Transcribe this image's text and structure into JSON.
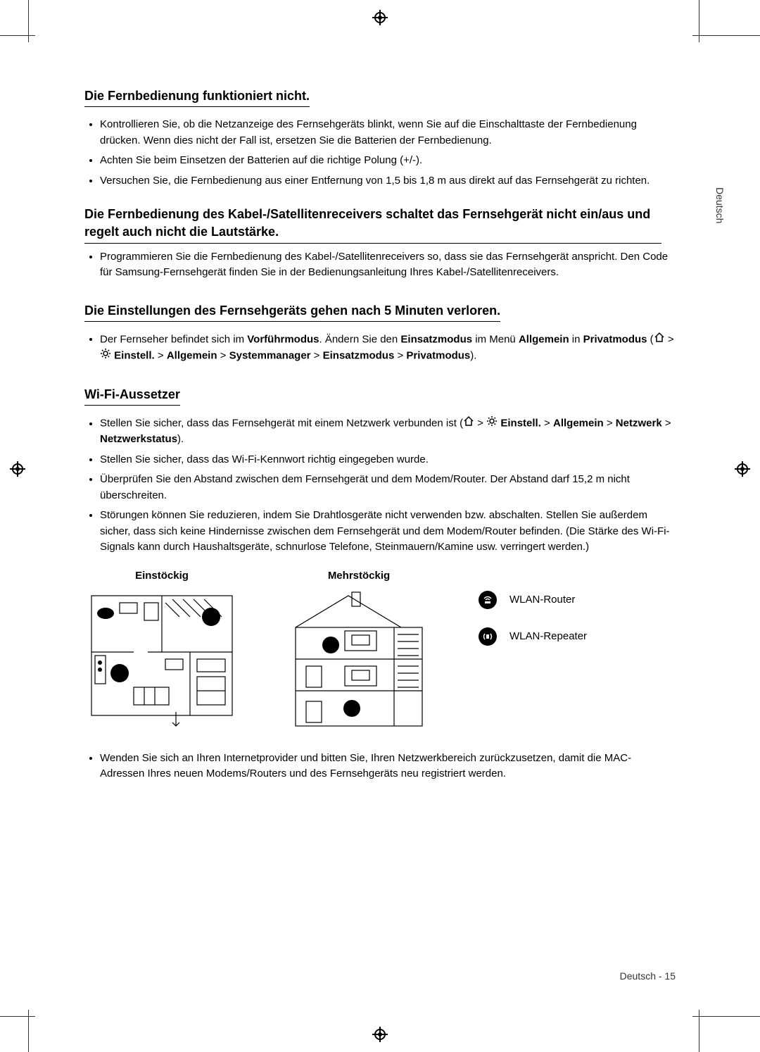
{
  "side_tab": "Deutsch",
  "footer": "Deutsch - 15",
  "sections": {
    "s1": {
      "heading": "Die Fernbedienung funktioniert nicht.",
      "b1": "Kontrollieren Sie, ob die Netzanzeige des Fernsehgeräts blinkt, wenn Sie auf die Einschalttaste der Fernbedienung drücken. Wenn dies nicht der Fall ist, ersetzen Sie die Batterien der Fernbedienung.",
      "b2": "Achten Sie beim Einsetzen der Batterien auf die richtige Polung (+/-).",
      "b3": "Versuchen Sie, die Fernbedienung aus einer Entfernung von 1,5 bis 1,8 m aus direkt auf das Fernsehgerät zu richten."
    },
    "s2": {
      "heading": "Die Fernbedienung des Kabel-/Satellitenreceivers schaltet das Fernsehgerät nicht ein/aus und regelt auch nicht die Lautstärke.",
      "b1": "Programmieren Sie die Fernbedienung des Kabel-/Satellitenreceivers so, dass sie das Fernsehgerät anspricht. Den Code für Samsung-Fernsehgerät finden Sie in der Bedienungsanleitung Ihres Kabel-/Satellitenreceivers."
    },
    "s3": {
      "heading": "Die Einstellungen des Fernsehgeräts gehen nach 5 Minuten verloren.",
      "b1_pre": "Der Fernseher befindet sich im ",
      "b1_bold1": "Vorführmodus",
      "b1_mid1": ". Ändern Sie den ",
      "b1_bold2": "Einsatzmodus",
      "b1_mid2": " im Menü ",
      "b1_bold3": "Allgemein",
      "b1_mid3": " in ",
      "b1_bold4": "Privatmodus",
      "b1_mid4": " (",
      "path_sep": " > ",
      "p_einstell": "Einstell.",
      "p_allgemein": "Allgemein",
      "p_sysman": "Systemmanager",
      "p_einsatz": "Einsatzmodus",
      "p_privat": "Privatmodus",
      "b1_end": ")."
    },
    "s4": {
      "heading": "Wi-Fi-Aussetzer",
      "b1_pre": "Stellen Sie sicher, dass das Fernsehgerät mit einem Netzwerk verbunden ist (",
      "p_einstell": "Einstell.",
      "p_allgemein": "Allgemein",
      "p_netzwerk": "Netzwerk",
      "p_netzstatus": "Netzwerkstatus",
      "b1_end": ").",
      "b2": "Stellen Sie sicher, dass das Wi-Fi-Kennwort richtig eingegeben wurde.",
      "b3": "Überprüfen Sie den Abstand zwischen dem Fernsehgerät und dem Modem/Router. Der Abstand darf 15,2 m nicht überschreiten.",
      "b4": "Störungen können Sie reduzieren, indem Sie Drahtlosgeräte nicht verwenden bzw. abschalten. Stellen Sie außerdem sicher, dass sich keine Hindernisse zwischen dem Fernsehgerät und dem Modem/Router befinden. (Die Stärke des Wi-Fi-Signals kann durch Haushaltsgeräte, schnurlose Telefone, Steinmauern/Kamine usw. verringert werden.)",
      "b5": "Wenden Sie sich an Ihren Internetprovider und bitten Sie, Ihren Netzwerkbereich zurückzusetzen, damit die MAC-Adressen Ihres neuen Modems/Routers und des Fernsehgeräts neu registriert werden."
    },
    "diagrams": {
      "single": "Einstöckig",
      "multi": "Mehrstöckig",
      "legend_router": "WLAN-Router",
      "legend_repeater": "WLAN-Repeater"
    }
  }
}
